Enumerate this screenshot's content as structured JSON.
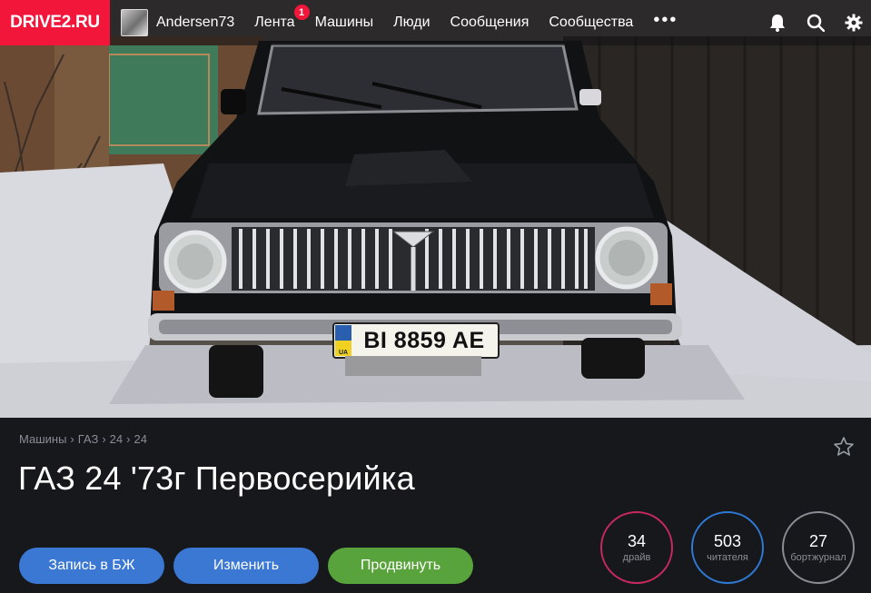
{
  "brand": {
    "logo": "DRIVE2.RU",
    "accent": "#f2163b"
  },
  "nav": {
    "user": "Andersen73",
    "items": [
      {
        "label": "Лента",
        "badge": "1"
      },
      {
        "label": "Машины"
      },
      {
        "label": "Люди"
      },
      {
        "label": "Сообщения"
      },
      {
        "label": "Сообщества"
      }
    ],
    "more": "•••",
    "icons": [
      "bell-icon",
      "search-icon",
      "gear-icon"
    ]
  },
  "hero": {
    "plate": "BI 8859 AE",
    "plate_country": "UA"
  },
  "breadcrumb": [
    "Машины",
    "ГАЗ",
    "24",
    "24"
  ],
  "car": {
    "title": "ГАЗ 24 '73г Первосерийка"
  },
  "actions": {
    "logbook": "Запись в БЖ",
    "edit": "Изменить",
    "promote": "Продвинуть"
  },
  "stats": {
    "drives": {
      "value": "34",
      "label": "драйв"
    },
    "readers": {
      "value": "503",
      "label": "читателя"
    },
    "journal": {
      "value": "27",
      "label": "бортжурнал"
    }
  },
  "colors": {
    "blue": "#3a78d4",
    "green": "#59a33c",
    "pink": "#c7295c",
    "gray": "#8a8d93"
  }
}
